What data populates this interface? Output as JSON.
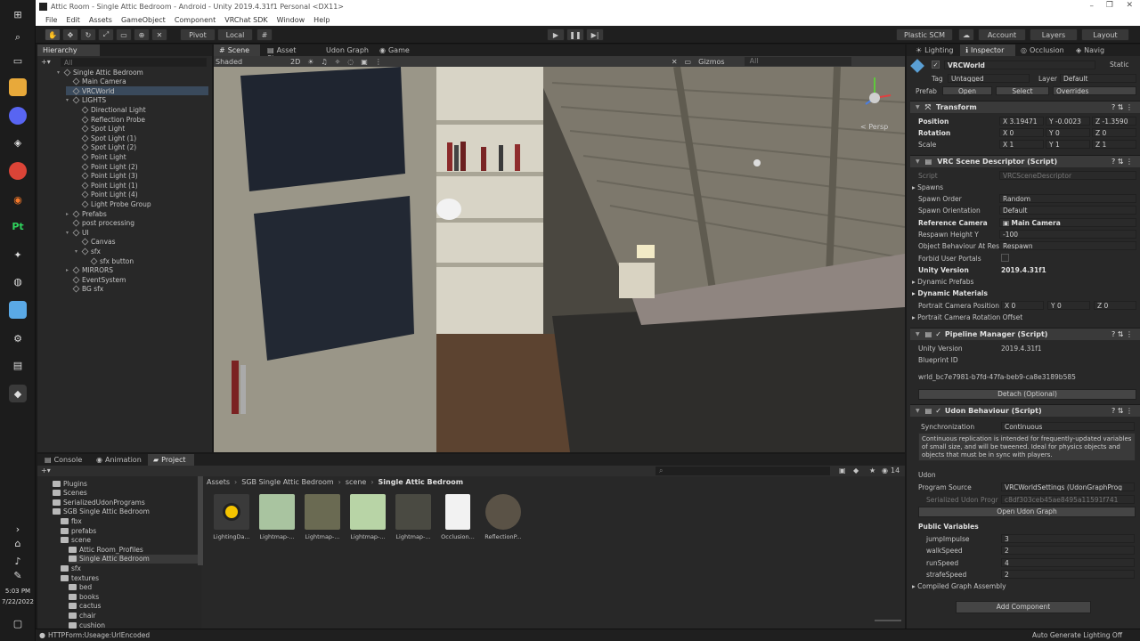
{
  "window": {
    "title": "Attic Room - Single Attic Bedroom - Android - Unity 2019.4.31f1 Personal <DX11>",
    "menu": [
      "File",
      "Edit",
      "Assets",
      "GameObject",
      "Component",
      "VRChat SDK",
      "Window",
      "Help"
    ]
  },
  "taskbar": {
    "time": "5:03 PM",
    "date": "7/22/2022"
  },
  "toolbar": {
    "pivot": "Pivot",
    "local": "Local",
    "plastic": "Plastic SCM",
    "account": "Account",
    "layers": "Layers",
    "layout": "Layout"
  },
  "hierarchy": {
    "tab": "Hierarchy",
    "search_placeholder": "All",
    "items": [
      {
        "label": "Single Attic Bedroom",
        "indent": 0
      },
      {
        "label": "Main Camera",
        "indent": 1
      },
      {
        "label": "VRCWorld",
        "indent": 1
      },
      {
        "label": "LIGHTS",
        "indent": 1
      },
      {
        "label": "Directional Light",
        "indent": 2
      },
      {
        "label": "Reflection Probe",
        "indent": 2
      },
      {
        "label": "Spot Light",
        "indent": 2
      },
      {
        "label": "Spot Light (1)",
        "indent": 2
      },
      {
        "label": "Spot Light (2)",
        "indent": 2
      },
      {
        "label": "Point Light",
        "indent": 2
      },
      {
        "label": "Point Light (2)",
        "indent": 2
      },
      {
        "label": "Point Light (3)",
        "indent": 2
      },
      {
        "label": "Point Light (1)",
        "indent": 2
      },
      {
        "label": "Point Light (4)",
        "indent": 2
      },
      {
        "label": "Light Probe Group",
        "indent": 2
      },
      {
        "label": "Prefabs",
        "indent": 1
      },
      {
        "label": "post processing",
        "indent": 1
      },
      {
        "label": "UI",
        "indent": 1
      },
      {
        "label": "Canvas",
        "indent": 2
      },
      {
        "label": "sfx",
        "indent": 2
      },
      {
        "label": "sfx button",
        "indent": 3
      },
      {
        "label": "MIRRORS",
        "indent": 1
      },
      {
        "label": "EventSystem",
        "indent": 1
      },
      {
        "label": "BG sfx",
        "indent": 1
      }
    ]
  },
  "scene": {
    "tabs": [
      "Scene",
      "Asset Store",
      "Udon Graph",
      "Game"
    ],
    "shading": "Shaded",
    "mode_2d": "2D",
    "gizmos": "Gizmos",
    "search_placeholder": "All",
    "persp": "< Persp"
  },
  "bottom": {
    "tabs": [
      "Console",
      "Animation",
      "Project"
    ],
    "breadcrumb": [
      "Assets",
      "SGB Single Attic Bedroom",
      "scene",
      "Single Attic Bedroom"
    ],
    "count": "14",
    "tree": [
      {
        "label": "Plugins",
        "indent": 1
      },
      {
        "label": "Scenes",
        "indent": 1
      },
      {
        "label": "SerializedUdonPrograms",
        "indent": 1
      },
      {
        "label": "SGB Single Attic Bedroom",
        "indent": 1
      },
      {
        "label": "fbx",
        "indent": 2
      },
      {
        "label": "prefabs",
        "indent": 2
      },
      {
        "label": "scene",
        "indent": 2
      },
      {
        "label": "Attic Room_Profiles",
        "indent": 3
      },
      {
        "label": "Single Attic Bedroom",
        "indent": 3
      },
      {
        "label": "sfx",
        "indent": 2
      },
      {
        "label": "textures",
        "indent": 2
      },
      {
        "label": "bed",
        "indent": 3
      },
      {
        "label": "books",
        "indent": 3
      },
      {
        "label": "cactus",
        "indent": 3
      },
      {
        "label": "chair",
        "indent": 3
      },
      {
        "label": "cushion",
        "indent": 3
      }
    ],
    "assets": [
      "LightingDa...",
      "Lightmap-...",
      "Lightmap-...",
      "Lightmap-...",
      "Lightmap-...",
      "Occlusion...",
      "ReflectionP..."
    ]
  },
  "status": {
    "left": "HTTPForm:Useage:UrlEncoded",
    "right": "Auto Generate Lighting Off"
  },
  "inspector": {
    "tabs": [
      "Lighting",
      "Inspector",
      "Occlusion",
      "Navig"
    ],
    "object_name": "VRCWorld",
    "static": "Static",
    "tag_label": "Tag",
    "tag": "Untagged",
    "layer_label": "Layer",
    "layer": "Default",
    "prefab_label": "Prefab",
    "prefab_open": "Open",
    "prefab_select": "Select",
    "prefab_overrides": "Overrides",
    "transform": {
      "title": "Transform",
      "position_label": "Position",
      "rotation_label": "Rotation",
      "scale_label": "Scale",
      "position": [
        "X 3.19471",
        "Y -0.0023",
        "Z -1.3590"
      ],
      "rotation": [
        "X 0",
        "Y 0",
        "Z 0"
      ],
      "scale": [
        "X 1",
        "Y 1",
        "Z 1"
      ]
    },
    "scene_descriptor": {
      "title": "VRC Scene Descriptor (Script)",
      "script_label": "Script",
      "script": "VRCSceneDescriptor",
      "spawns": "Spawns",
      "spawn_order_label": "Spawn Order",
      "spawn_order": "Random",
      "spawn_orientation_label": "Spawn Orientation",
      "spawn_orientation": "Default",
      "ref_camera_label": "Reference Camera",
      "ref_camera": "Main Camera",
      "respawn_label": "Respawn Height Y",
      "respawn": "-100",
      "object_behaviour_label": "Object Behaviour At Res",
      "object_behaviour": "Respawn",
      "forbid_label": "Forbid User Portals",
      "unity_version_label": "Unity Version",
      "unity_version": "2019.4.31f1",
      "dynamic_prefabs": "Dynamic Prefabs",
      "dynamic_materials": "Dynamic Materials",
      "portrait_pos_label": "Portrait Camera Position",
      "portrait_pos": [
        "X 0",
        "Y 0",
        "Z 0"
      ],
      "portrait_rot_label": "Portrait Camera Rotation Offset"
    },
    "pipeline": {
      "title": "Pipeline Manager (Script)",
      "unity_version_label": "Unity Version",
      "unity_version": "2019.4.31f1",
      "blueprint_label": "Blueprint ID",
      "blueprint": "wrld_bc7e7981-b7fd-47fa-beb9-ca8e3189b585",
      "detach": "Detach (Optional)"
    },
    "udon": {
      "title": "Udon Behaviour (Script)",
      "sync_label": "Synchronization",
      "sync": "Continuous",
      "sync_help": "Continuous replication is intended for frequently-updated variables of small size, and will be tweened. Ideal for physics objects and objects that must be in sync with players.",
      "udon_label": "Udon",
      "program_source_label": "Program Source",
      "program_source": "VRCWorldSettings (UdonGraphProg",
      "serialized_label": "Serialized Udon Progr",
      "serialized": "c8df303ceb45ae8495a11591f741",
      "open_graph": "Open Udon Graph",
      "public_vars": "Public Variables",
      "vars": [
        {
          "name": "jumpImpulse",
          "value": "3"
        },
        {
          "name": "walkSpeed",
          "value": "2"
        },
        {
          "name": "runSpeed",
          "value": "4"
        },
        {
          "name": "strafeSpeed",
          "value": "2"
        }
      ],
      "compiled": "Compiled Graph Assembly"
    },
    "add_component": "Add Component"
  }
}
